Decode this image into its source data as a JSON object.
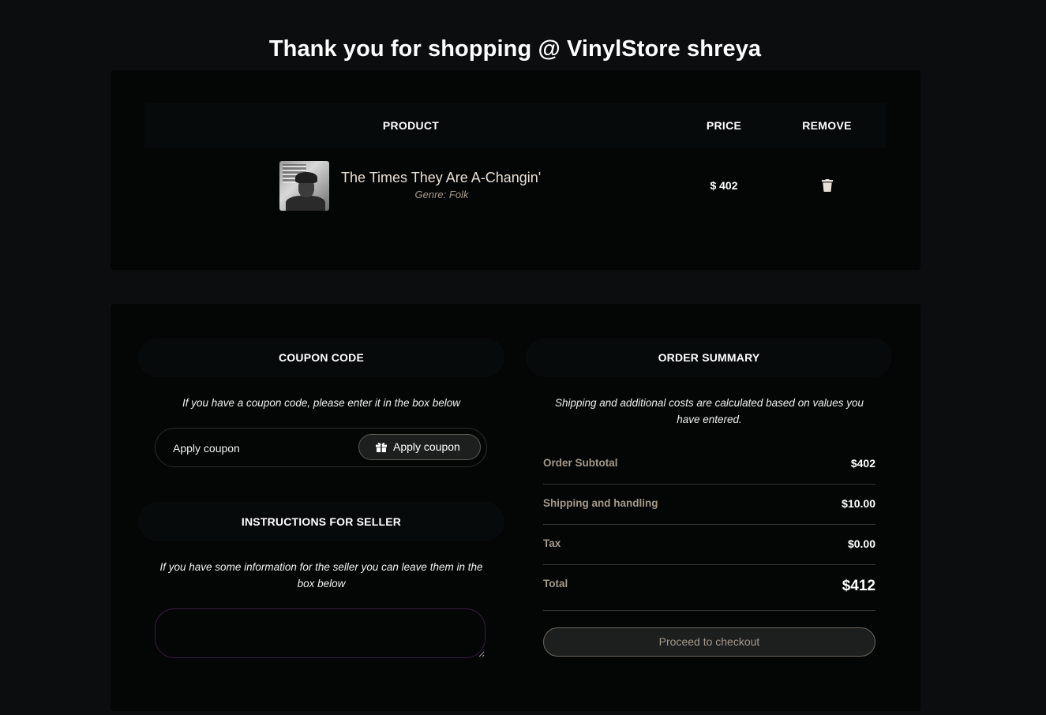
{
  "page": {
    "title": "Thank you for shopping @ VinylStore shreya"
  },
  "cart": {
    "headers": {
      "product": "PRODUCT",
      "price": "PRICE",
      "remove": "REMOVE"
    },
    "items": [
      {
        "name": "The Times They Are A-Changin'",
        "genre": "Genre: Folk",
        "price": "$ 402",
        "thumbnail_icon": "album-cover-image",
        "remove_icon": "trash-icon"
      }
    ]
  },
  "coupon": {
    "heading": "COUPON CODE",
    "hint": "If you have a coupon code, please enter it in the box below",
    "input_placeholder": "Apply coupon",
    "button_label": "Apply coupon",
    "button_icon": "gift-icon"
  },
  "seller": {
    "heading": "INSTRUCTIONS FOR SELLER",
    "hint": "If you have some information for the seller you can leave them in the box below",
    "textarea_value": ""
  },
  "summary": {
    "heading": "ORDER SUMMARY",
    "hint": "Shipping and additional costs are calculated based on values you have entered.",
    "rows": [
      {
        "label": "Order Subtotal",
        "value": "$402"
      },
      {
        "label": "Shipping and handling",
        "value": "$10.00"
      },
      {
        "label": "Tax",
        "value": "$0.00"
      },
      {
        "label": "Total",
        "value": "$412"
      }
    ],
    "checkout_label": "Proceed to checkout"
  },
  "colors": {
    "page_bg": "#0c0d0f",
    "card_bg": "#040505",
    "header_bg": "#070a0b",
    "muted_text": "#a49a8c",
    "textarea_border": "#3a1f40"
  }
}
